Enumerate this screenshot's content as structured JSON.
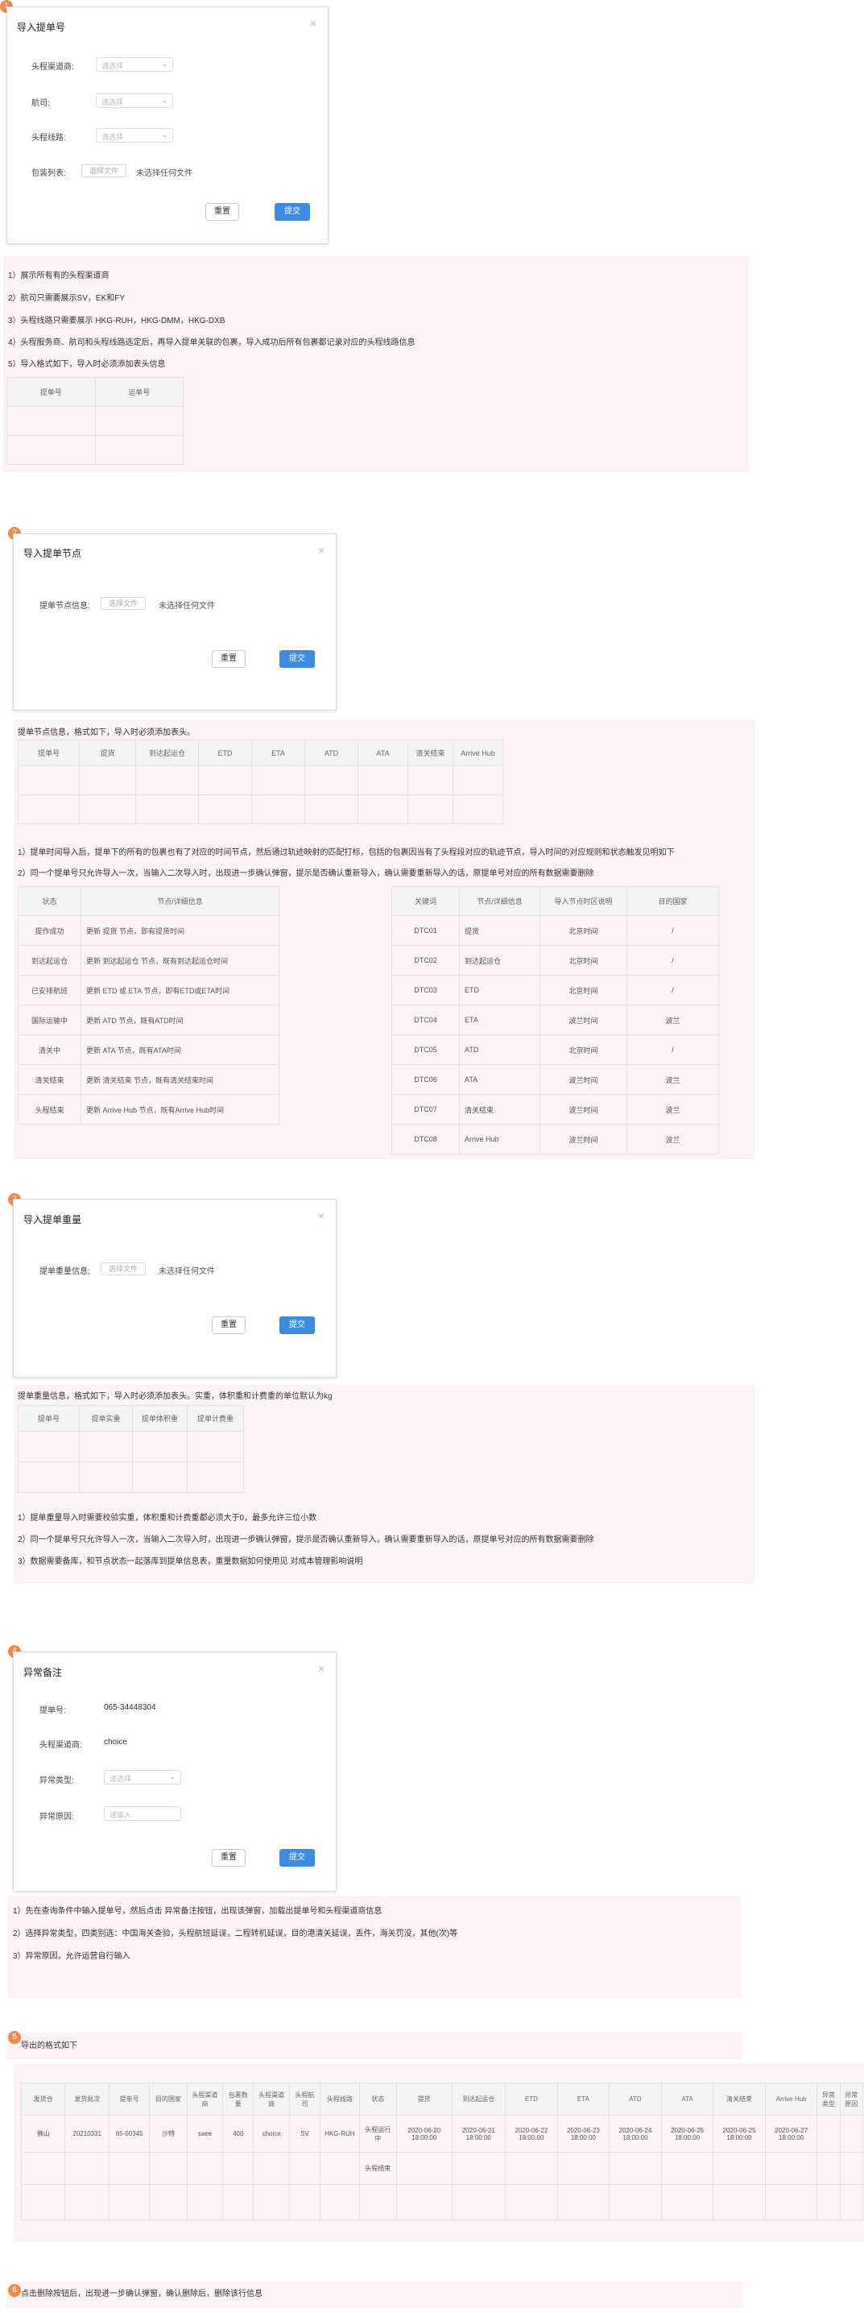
{
  "s1": {
    "badge": "1",
    "title": "导入提单号",
    "close": "×",
    "fields": [
      {
        "label": "头程渠道商:",
        "placeholder": "请选择"
      },
      {
        "label": "航司:",
        "placeholder": "请选择"
      },
      {
        "label": "头程线路:",
        "placeholder": "请选择"
      }
    ],
    "pack_label": "包装列表:",
    "file_btn": "选择文件",
    "file_hint": "未选择任何文件",
    "reset": "重置",
    "submit": "提交",
    "notes": [
      "1）展示所有有的头程渠道商",
      "2）航司只需要展示SV，EK和FY",
      "3）头程线路只需要展示 HKG-RUH，HKG-DMM，HKG-DXB",
      "4）头程服务商、航司和头程线路选定后，再导入提单关联的包裹，导入成功后所有包裹都记录对应的头程线路信息",
      "5）导入格式如下，导入时必须添加表头信息"
    ],
    "table_headers": [
      "提单号",
      "运单号"
    ]
  },
  "s2": {
    "badge": "2",
    "title": "导入提单节点",
    "close": "×",
    "label": "提单节点信息:",
    "file_btn": "选择文件",
    "file_hint": "未选择任何文件",
    "reset": "重置",
    "submit": "提交",
    "intro": "提单节点信息，格式如下，导入时必须添加表头。",
    "table_headers": [
      "提单号",
      "提货",
      "到达起运仓",
      "ETD",
      "ETA",
      "ATD",
      "ATA",
      "清关结束",
      "Arrive Hub"
    ],
    "notes": [
      "1）提单时间导入后，提单下的所有的包裹也有了对应的时间节点，然后通过轨迹映射的匹配打标，包括的包裹因当有了头程段对应的轨迹节点，导入时间的对应规则和状态触发见明如下",
      "2）同一个提单号只允许导入一次，当输入二次导入时，出现进一步确认弹窗，提示是否确认重新导入，确认需要重新导入的话，原提单号对应的所有数据需要删除"
    ],
    "status_headers": [
      "状态",
      "节点/详细信息"
    ],
    "status_rows": [
      [
        "提作成功",
        "更新 提货 节点，即有提货时间"
      ],
      [
        "到达起运仓",
        "更新 到达起运仓 节点，既有到达起运仓时间"
      ],
      [
        "已安排航班",
        "更新 ETD 或 ETA 节点，即有ETD或ETA时间"
      ],
      [
        "国际运输中",
        "更新 ATD 节点，既有ATD时间"
      ],
      [
        "清关中",
        "更新 ATA 节点，既有ATA时间"
      ],
      [
        "清关结束",
        "更新 清关结束 节点，既有清关结束时间"
      ],
      [
        "头程结束",
        "更新 Arrive Hub 节点，既有Arrive Hub时间"
      ]
    ],
    "code_headers": [
      "关键词",
      "节点/详细信息",
      "导入节点时区说明",
      "目的国家"
    ],
    "code_rows": [
      [
        "DTC01",
        "提货",
        "北京时间",
        "/"
      ],
      [
        "DTC02",
        "到达起运仓",
        "北京时间",
        "/"
      ],
      [
        "DTC03",
        "ETD",
        "北京时间",
        "/"
      ],
      [
        "DTC04",
        "ETA",
        "波兰时间",
        "波兰"
      ],
      [
        "DTC05",
        "ATD",
        "北京时间",
        "/"
      ],
      [
        "DTC06",
        "ATA",
        "波兰时间",
        "波兰"
      ],
      [
        "DTC07",
        "清关结束",
        "波兰时间",
        "波兰"
      ],
      [
        "DTC08",
        "Arrive Hub",
        "波兰时间",
        "波兰"
      ]
    ]
  },
  "s3": {
    "badge": "3",
    "title": "导入提单重量",
    "close": "×",
    "label": "提单重量信息:",
    "file_btn": "选择文件",
    "file_hint": "未选择任何文件",
    "reset": "重置",
    "submit": "提交",
    "intro": "提单重量信息，格式如下，导入时必须添加表头。实重，体积重和计费重的单位默认为kg",
    "table_headers": [
      "提单号",
      "提单实重",
      "提单体积重",
      "提单计费重"
    ],
    "notes": [
      "1）提单重量导入时需要校验实重，体积重和计费重都必须大于0，最多允许三位小数",
      "2）同一个提单号只允许导入一次，当输入二次导入时，出现进一步确认弹窗，提示是否确认重新导入，确认需要重新导入的话，原提单号对应的所有数据需要删除",
      "3）数据需要备库，和节点状态一起落库到提单信息表，重量数据如何使用见 对成本管理影响说明"
    ]
  },
  "s4": {
    "badge": "4",
    "title": "异常备注",
    "close": "×",
    "bill_label": "提单号:",
    "bill_value": "065-34448304",
    "channel_label": "头程渠道商:",
    "channel_value": "choice",
    "type_label": "异常类型:",
    "type_placeholder": "请选择",
    "reason_label": "异常原因:",
    "reason_placeholder": "请输入",
    "reset": "重置",
    "submit": "提交",
    "notes": [
      "1）先在查询条件中输入提单号，然后点击 异常备注按钮，出现该弹窗，加载出提单号和头程渠道商信息",
      "2）选择异常类型，四类别选：中国海关查验，头程航班延误，二程转机延误，目的港清关延误，丢件，海关罚没，其他(次)等",
      "3）异常原因，允许运营自行输入"
    ]
  },
  "s5": {
    "badge": "5",
    "intro": "导出的格式如下",
    "headers": [
      "发货仓",
      "发货批次",
      "提单号",
      "目的国家",
      "头程渠道商",
      "包裹数量",
      "头程渠道商",
      "头程航司",
      "头程线路",
      "状态",
      "提货",
      "到达起运仓",
      "ETD",
      "ETA",
      "ATD",
      "ATA",
      "清关结束",
      "Arrive Hub",
      "异常类型",
      "异常原因"
    ],
    "row1": [
      "佛山",
      "20210331",
      "65-00345",
      "沙特",
      "saee",
      "400",
      "choice",
      "SV",
      "HKG-RUH",
      "头程运行中",
      "2020-06-20 18:00:00",
      "2020-06-21 18:00:00",
      "2020-06-22 18:00:00",
      "2020-06-23 18:00:00",
      "2020-06-24 18:00:00",
      "2020-06-25 18:00:00",
      "2020-06-25 18:00:00",
      "2020-06-27 18:00:00",
      "",
      ""
    ],
    "row2_status": "头程结束"
  },
  "s6": {
    "badge": "6",
    "intro": "点击删除按钮后，出现进一步确认弹窗，确认删除后，删除该行信息"
  }
}
